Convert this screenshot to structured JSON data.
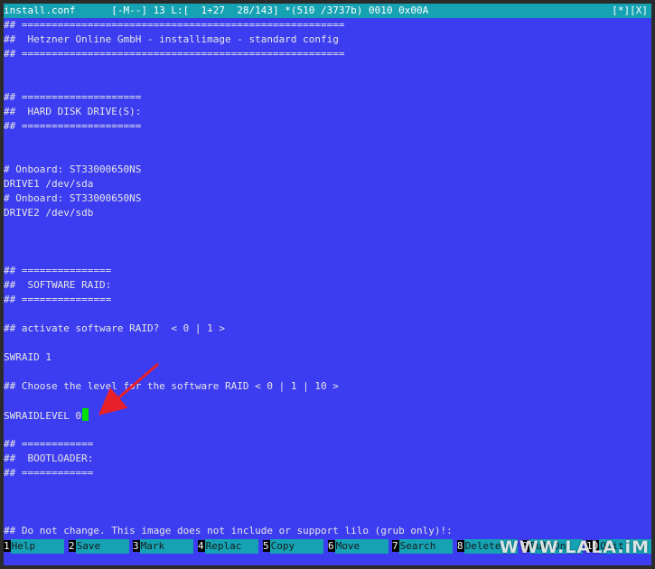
{
  "status_bar": {
    "left": "install.conf      [-M--] 13 L:[  1+27  28/143] *(510 /3737b) 0010 0x00A",
    "right": "[*][X]"
  },
  "lines": [
    "## ======================================================",
    "##  Hetzner Online GmbH - installimage - standard config",
    "## ======================================================",
    "",
    "",
    "## ====================",
    "##  HARD DISK DRIVE(S):",
    "## ====================",
    "",
    "",
    "# Onboard: ST33000650NS",
    "DRIVE1 /dev/sda",
    "# Onboard: ST33000650NS",
    "DRIVE2 /dev/sdb",
    "",
    "",
    "",
    "## ===============",
    "##  SOFTWARE RAID:",
    "## ===============",
    "",
    "## activate software RAID?  < 0 | 1 >",
    "",
    "SWRAID 1",
    "",
    "## Choose the level for the software RAID < 0 | 1 | 10 >",
    "",
    "SWRAIDLEVEL 0",
    "",
    "## ============",
    "##  BOOTLOADER:",
    "## ============",
    "",
    "",
    "",
    "## Do not change. This image does not include or support lilo (grub only)!:"
  ],
  "function_keys": [
    {
      "num": "1",
      "label": "Help"
    },
    {
      "num": "2",
      "label": "Save"
    },
    {
      "num": "3",
      "label": "Mark"
    },
    {
      "num": "4",
      "label": "Replac"
    },
    {
      "num": "5",
      "label": "Copy"
    },
    {
      "num": "6",
      "label": "Move"
    },
    {
      "num": "7",
      "label": "Search"
    },
    {
      "num": "8",
      "label": "Delete"
    },
    {
      "num": "9",
      "label": "PullDn"
    },
    {
      "num": "10",
      "label": "Quit"
    }
  ],
  "watermark": "WWW.LALA.iM",
  "colors": {
    "background": "#3c3cf0",
    "bar": "#15a3b3",
    "cursor": "#00e000",
    "arrow": "#e8202a"
  },
  "cursor_line_index": 27
}
